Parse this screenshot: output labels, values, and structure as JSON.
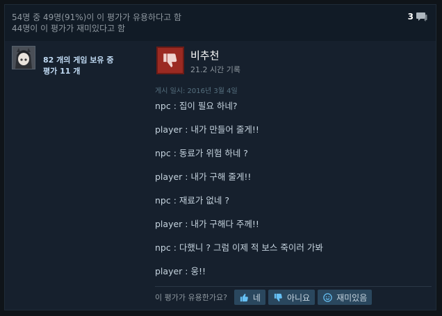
{
  "helpful": {
    "line1": "54명 중 49명(91%)이 이 평가가 유용하다고 함",
    "line2": "44명이 이 평가가 재미있다고 함",
    "comments": "3"
  },
  "author": {
    "games_owned": "82 개의 게임 보유 중",
    "reviews": "평가 11 개"
  },
  "review": {
    "verdict": "비추천",
    "verdict_icon": "thumbs-down-icon",
    "hours": "21.2 시간 기록",
    "posted": "게시 일시: 2016년 3월 4일",
    "lines": [
      "npc : 집이 필요 하네?",
      "player : 내가 만들어 줄게!!",
      "npc : 동료가 위험 하네 ?",
      "player : 내가 구해 줄게!!",
      "npc : 재료가 없네 ?",
      "player : 내가 구해다 주께!!",
      "npc : 다했니 ? 그럼 이제 적 보스 죽이러 가봐",
      "player : 웅!!"
    ]
  },
  "vote": {
    "prompt": "이 평가가 유용한가요?",
    "yes": "네",
    "no": "아니요",
    "funny": "재미있음"
  },
  "colors": {
    "accent": "#66c0f4",
    "thumbs_down": "#9b2a22",
    "button_bg": "#2a475e"
  }
}
